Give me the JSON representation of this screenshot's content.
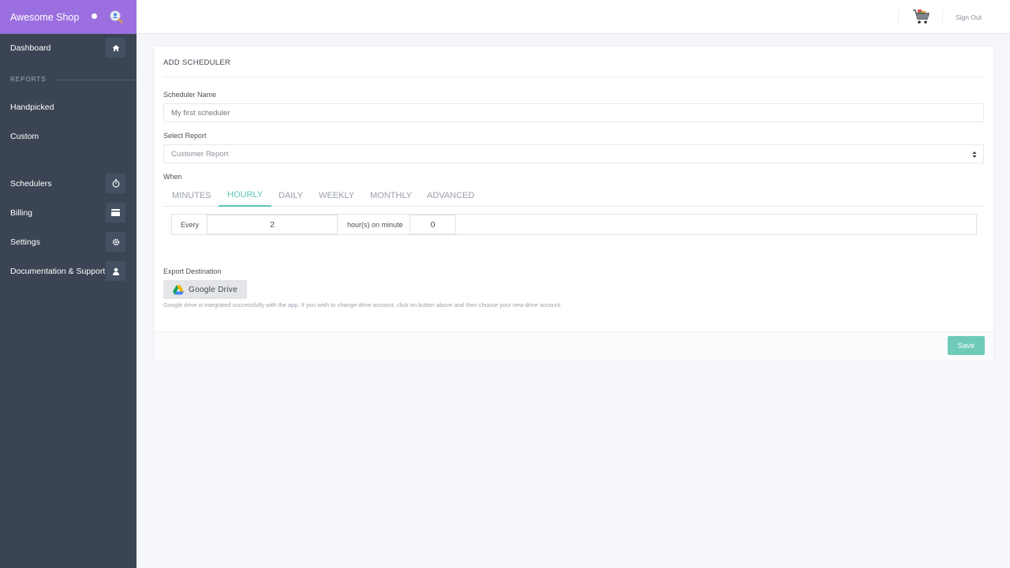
{
  "brand": {
    "name": "Awesome Shop",
    "icon": "search-user-icon"
  },
  "sidebar": {
    "dashboard": {
      "label": "Dashboard",
      "icon": "home-icon"
    },
    "section_reports": "REPORTS",
    "handpicked": "Handpicked",
    "custom": "Custom",
    "schedulers": {
      "label": "Schedulers",
      "icon": "stopwatch-icon"
    },
    "billing": {
      "label": "Billing",
      "icon": "card-icon"
    },
    "settings": {
      "label": "Settings",
      "icon": "gear-icon"
    },
    "docs": {
      "label": "Documentation & Support",
      "icon": "user-icon"
    }
  },
  "topbar": {
    "signout": "Sign Out",
    "cart_icon": "cart-icon"
  },
  "form": {
    "title": "ADD SCHEDULER",
    "name_label": "Scheduler Name",
    "name_placeholder": "My first scheduler",
    "report_label": "Select Report",
    "report_value": "Customer Report",
    "when_label": "When",
    "tabs": [
      "MINUTES",
      "HOURLY",
      "DAILY",
      "WEEKLY",
      "MONTHLY",
      "ADVANCED"
    ],
    "active_tab": "HOURLY",
    "every_label": "Every",
    "every_value": "2",
    "on_minute_label": "hour(s) on minute",
    "minute_value": "0",
    "export_label": "Export Destination",
    "gdrive_label": "Google Drive",
    "gdrive_hint": "Google drive is integrated successfully with the app. If you wish to change drive account, click on button above and then choose your new drive account",
    "save_label": "Save"
  },
  "colors": {
    "brand": "#9b6fe0",
    "sidebar": "#3b4453",
    "accent": "#5cc6b6",
    "save": "#6fcbb8"
  }
}
